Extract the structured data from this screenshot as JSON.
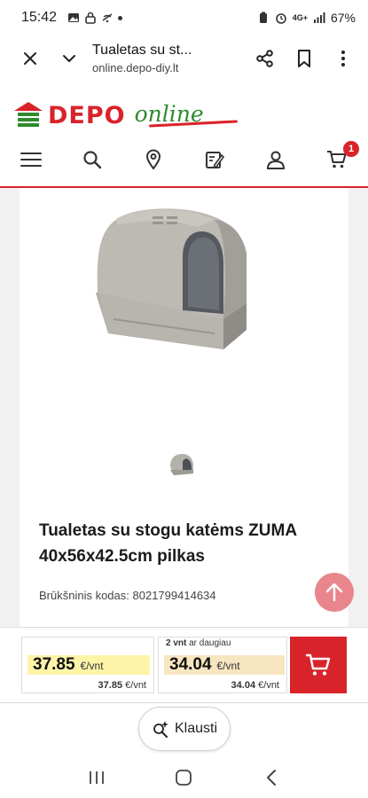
{
  "status_bar": {
    "time": "15:42",
    "battery": "67%",
    "network": "4G+"
  },
  "browser": {
    "title": "Tualetas su st...",
    "url": "online.depo-diy.lt"
  },
  "header": {
    "logo_brand": "DEPO",
    "logo_tagline": "online",
    "cart_count": "1",
    "nav_icons": [
      "menu-icon",
      "search-icon",
      "location-icon",
      "note-edit-icon",
      "user-icon",
      "cart-icon"
    ]
  },
  "product": {
    "title": "Tualetas su stogu katėms ZUMA 40x56x42.5cm pilkas",
    "barcode_label": "Brūkšninis kodas:",
    "barcode_value": "8021799414634"
  },
  "pricing": {
    "single": {
      "price": "37.85",
      "unit": "€/vnt",
      "sub_price": "37.85",
      "sub_unit": "€/vnt"
    },
    "bulk": {
      "label_qty": "2 vnt",
      "label_rest": "ar daugiau",
      "price": "34.04",
      "unit": "€/vnt",
      "sub_price": "34.04",
      "sub_unit": "€/vnt"
    }
  },
  "ask_button": {
    "label": "Klausti"
  },
  "colors": {
    "brand_red": "#d9232a",
    "brand_green": "#2e8b2e",
    "single_price_bg": "#fdf4a8",
    "bulk_price_bg": "#f7e6c0",
    "scroll_top_bg": "#e8868c"
  }
}
